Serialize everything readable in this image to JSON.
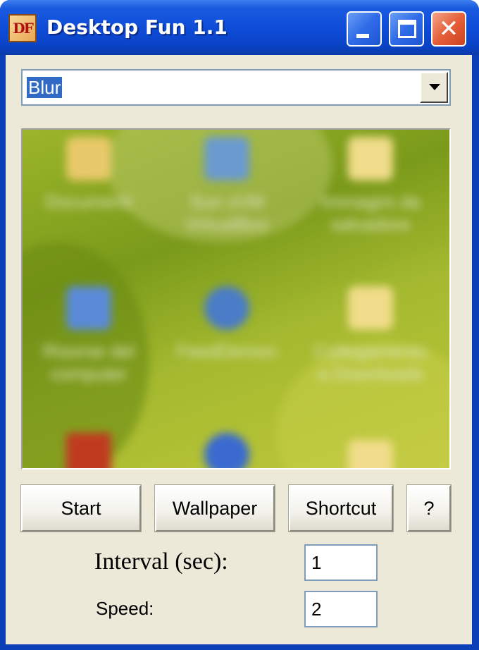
{
  "window": {
    "title": "Desktop Fun 1.1",
    "icon_text": "DF",
    "close_glyph": "✕"
  },
  "effect_select": {
    "value": "Blur"
  },
  "preview": {
    "icons": [
      {
        "label": "Documenti",
        "icon": "documents-folder-icon",
        "color": "#e8c96a"
      },
      {
        "label": "Sun xVM VirtualBox",
        "icon": "virtualbox-icon",
        "color": "#6a9ad0"
      },
      {
        "label": "Immagini da salvadore",
        "icon": "folder-icon",
        "color": "#f0dc8a"
      },
      {
        "label": "Risorse del computer",
        "icon": "my-computer-icon",
        "color": "#5a8ad8"
      },
      {
        "label": "FeedDemon",
        "icon": "feeddemon-icon",
        "color": "#4a7cc8"
      },
      {
        "label": "Collegamento a Downloads",
        "icon": "shortcut-folder-icon",
        "color": "#f0dc8a"
      },
      {
        "label": "",
        "icon": "red-app-icon",
        "color": "#c03a20"
      },
      {
        "label": "",
        "icon": "globe-icon",
        "color": "#3a6ad0"
      },
      {
        "label": "",
        "icon": "folder-icon",
        "color": "#f0dc8a"
      }
    ]
  },
  "buttons": {
    "start": "Start",
    "wallpaper": "Wallpaper",
    "shortcut": "Shortcut",
    "help": "?"
  },
  "fields": {
    "interval_label": "Interval (sec):",
    "interval_value": "1",
    "speed_label": "Speed:",
    "speed_value": "2"
  }
}
